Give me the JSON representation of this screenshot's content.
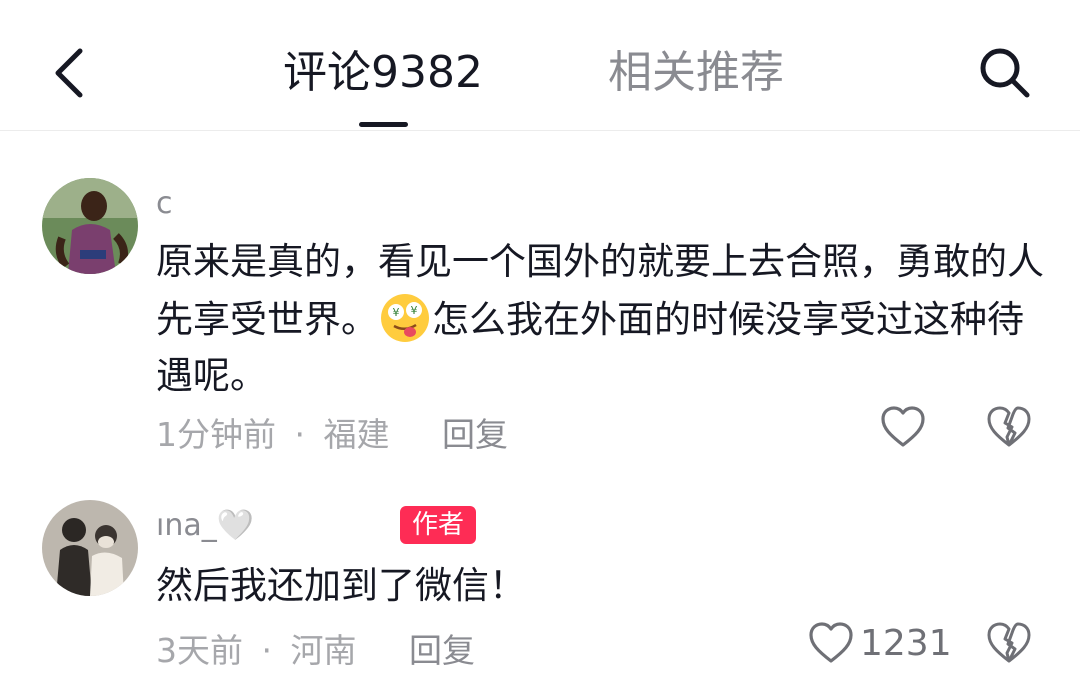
{
  "header": {
    "back_icon": "chevron-left-icon",
    "tabs": [
      {
        "label": "评论9382",
        "active": true
      },
      {
        "label": "相关推荐",
        "active": false
      }
    ],
    "search_icon": "search-icon"
  },
  "comments": [
    {
      "username": "c",
      "text_before_emoji": "原来是真的，看见一个国外的就要上去合照，勇敢的人先享受世界。",
      "emoji": "money-eyes-tongue-emoji",
      "text_after_emoji": "怎么我在外面的时候没享受过这种待遇呢。",
      "time": "1分钟前",
      "separator": "·",
      "location": "福建",
      "reply_label": "回复",
      "like_count": "",
      "like_icon": "heart-outline-icon",
      "dislike_icon": "broken-heart-icon"
    },
    {
      "username": "ına_🤍",
      "badge": "作者",
      "text": "然后我还加到了微信！",
      "time": "3天前",
      "separator": "·",
      "location": "河南",
      "reply_label": "回复",
      "like_count": "1231",
      "like_icon": "heart-outline-icon",
      "dislike_icon": "broken-heart-icon"
    }
  ],
  "colors": {
    "primary_text": "#161823",
    "secondary_text": "#8a8b91",
    "badge_bg": "#fe2c55"
  }
}
